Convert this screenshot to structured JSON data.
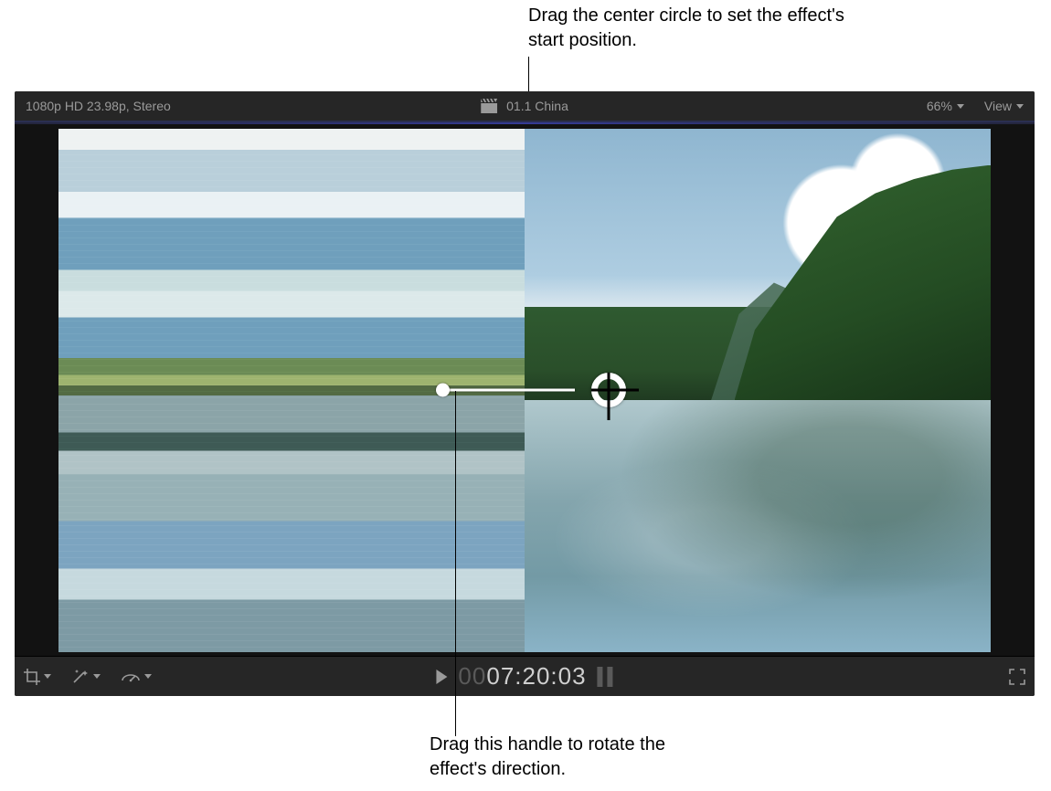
{
  "callouts": {
    "top": "Drag the center circle to set the effect's start position.",
    "bottom": "Drag this handle to rotate the effect's direction."
  },
  "topbar": {
    "format_label": "1080p HD 23.98p, Stereo",
    "clip_title": "01.1 China",
    "zoom_label": "66%",
    "view_label": "View"
  },
  "bottombar": {
    "timecode_dim_prefix": "00",
    "timecode_bright_h": "0",
    "timecode_rest": "7:20:03"
  },
  "icons": {
    "clapper": "clapper-icon",
    "crop": "crop-icon",
    "wand": "wand-icon",
    "retime": "retime-icon",
    "play": "play-icon",
    "loop": "loop-icon",
    "fullscreen": "fullscreen-icon"
  },
  "controls": {
    "center_circle_name": "effect-center-handle",
    "rotate_handle_name": "effect-rotate-handle"
  }
}
